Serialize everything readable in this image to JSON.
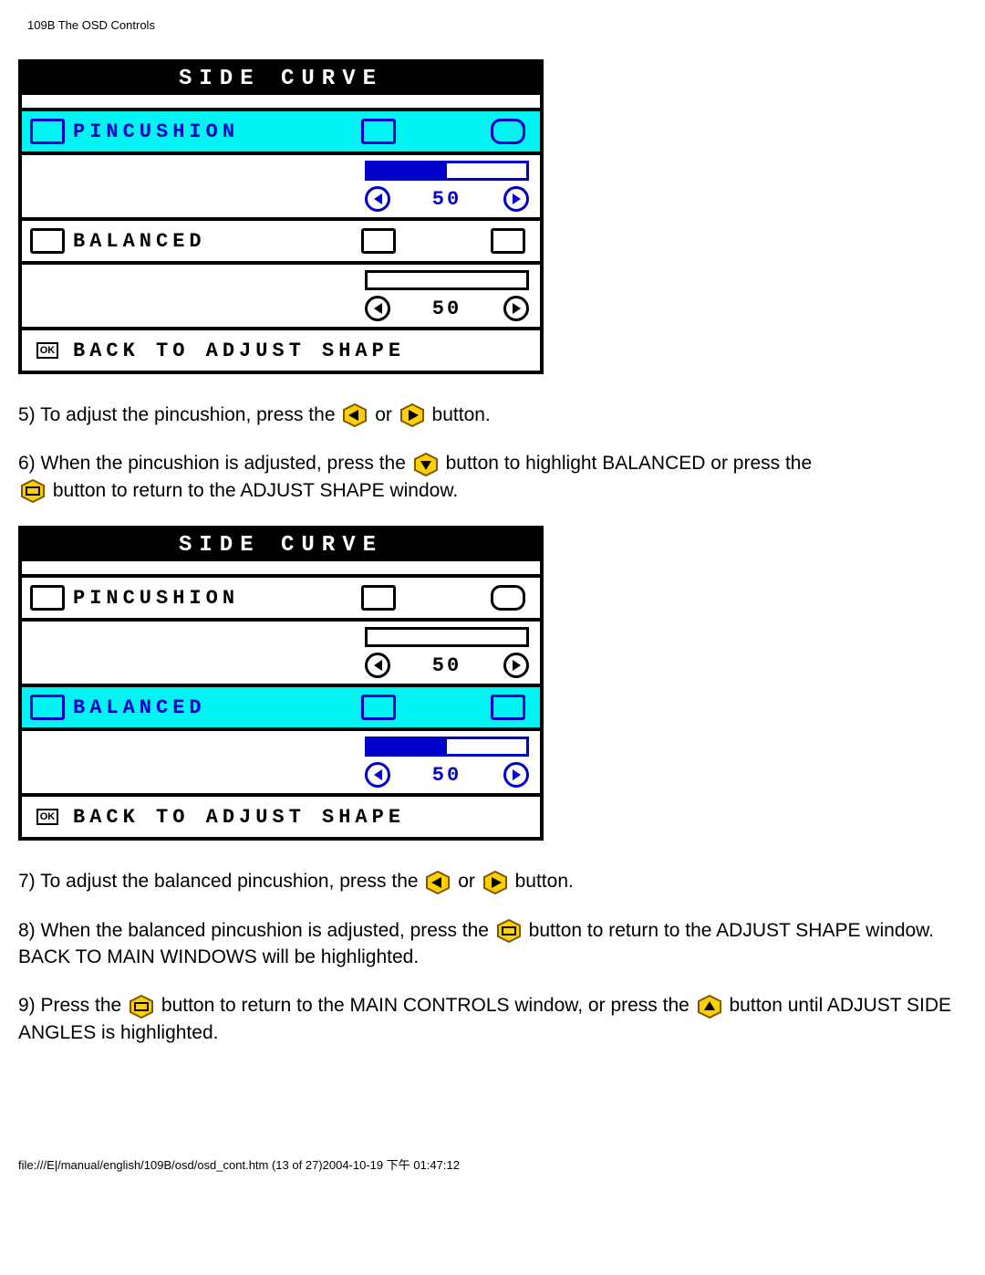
{
  "page_header": "109B The OSD Controls",
  "osd": {
    "title": "SIDE CURVE",
    "items": {
      "pincushion": {
        "label": "PINCUSHION",
        "value": "50"
      },
      "balanced": {
        "label": "BALANCED",
        "value": "50"
      }
    },
    "footer_ok": "OK",
    "footer_label": "BACK TO ADJUST SHAPE"
  },
  "steps": {
    "s5a": "5) To adjust the pincushion, press the ",
    "s5b": " or ",
    "s5c": " button.",
    "s6a": "6) When the pincushion is adjusted, press the ",
    "s6b": " button to highlight BALANCED or press the ",
    "s6c": " button to return to the ADJUST SHAPE window.",
    "s7a": "7) To adjust the balanced pincushion, press the ",
    "s7b": " or ",
    "s7c": " button.",
    "s8a": "8) When the balanced pincushion is adjusted, press the ",
    "s8b": " button to return to the ADJUST SHAPE window. BACK TO MAIN WINDOWS will be highlighted.",
    "s9a": "9) Press the ",
    "s9b": " button to return to the MAIN CONTROLS window, or press the ",
    "s9c": " button until ADJUST SIDE ANGLES is highlighted."
  },
  "page_footer": "file:///E|/manual/english/109B/osd/osd_cont.htm (13 of 27)2004-10-19 下午 01:47:12"
}
